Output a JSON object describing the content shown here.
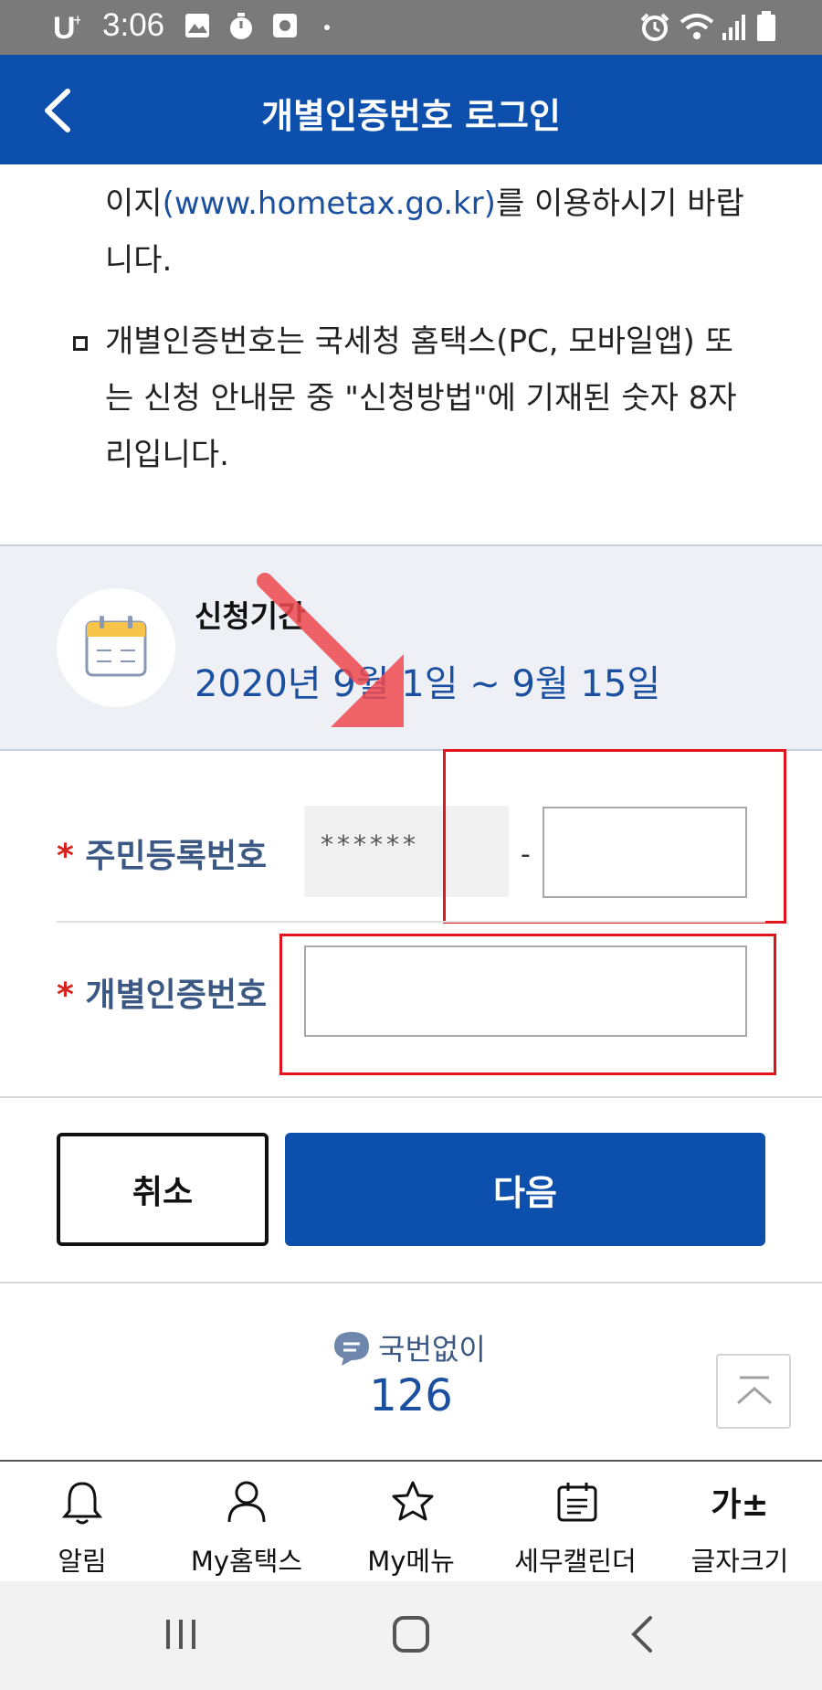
{
  "status_bar": {
    "time": "3:06"
  },
  "header": {
    "title": "개별인증번호 로그인"
  },
  "info": {
    "line1_prefix": "이지",
    "line1_link": "(www.hometax.go.kr)",
    "line1_suffix": "를 이용하시기 바랍",
    "line2": "니다.",
    "bullet_line1": "개별인증번호는 국세청 홈택스(PC, 모바일앱) 또",
    "bullet_line2": "는 신청 안내문 중 \"신청방법\"에 기재된 숫자 8자",
    "bullet_line3": "리입니다."
  },
  "period": {
    "label": "신청기간",
    "dates": "2020년 9월 1일 ~ 9월 15일"
  },
  "form": {
    "required_mark": "*",
    "resident_label": "주민등록번호",
    "resident_masked": "******",
    "dash": "-",
    "resident_back_value": "",
    "auth_label": "개별인증번호",
    "auth_value": ""
  },
  "buttons": {
    "cancel": "취소",
    "next": "다음"
  },
  "contact": {
    "label": "국번없이",
    "number": "126"
  },
  "bottom_nav": [
    {
      "label": "알림",
      "icon": "bell-icon"
    },
    {
      "label": "My홈택스",
      "icon": "person-icon"
    },
    {
      "label": "My메뉴",
      "icon": "star-icon"
    },
    {
      "label": "세무캘린더",
      "icon": "calendar-icon"
    },
    {
      "label": "글자크기",
      "icon": "text-size-icon",
      "glyph": "가±"
    }
  ],
  "colors": {
    "header": "#0c4fad",
    "accent_text": "#1b4fa0",
    "annotation_red": "#e0141c",
    "required": "#d8201d"
  }
}
